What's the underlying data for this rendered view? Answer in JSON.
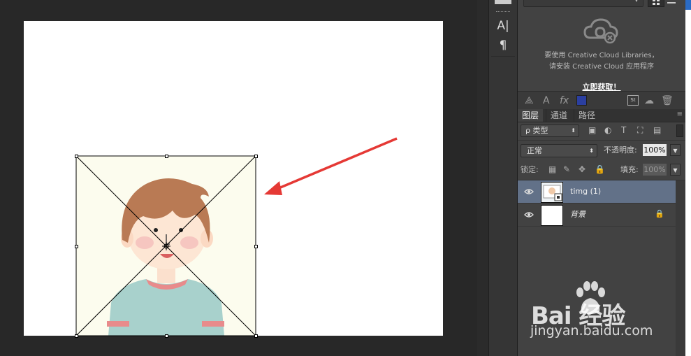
{
  "canvas": {
    "document_color": "#ffffff",
    "photo_bg": "#fcfcee",
    "arrow_color": "#e53935"
  },
  "toolbar": {
    "tools": [
      {
        "name": "character",
        "glyph": "A|"
      },
      {
        "name": "paragraph",
        "glyph": "¶"
      }
    ]
  },
  "libraries": {
    "message_line1": "要使用 Creative Cloud Libraries，",
    "message_line2": "请安装 Creative Cloud 应用程序",
    "get_link": "立即获取！",
    "fx_label": "fx",
    "text_tool": "A",
    "stock_label": "St",
    "color_swatch": "#2b3fa0"
  },
  "layers_panel": {
    "tabs": [
      "图层",
      "通道",
      "路径"
    ],
    "active_tab": "图层",
    "filter_kind": "ρ 类型",
    "blend_mode": "正常",
    "opacity_label": "不透明度:",
    "opacity_value": "100%",
    "lock_label": "锁定:",
    "fill_label": "填充:",
    "fill_value": "100%",
    "layers": [
      {
        "name": "timg (1)",
        "selected": true,
        "visible": true,
        "locked": false
      },
      {
        "name": "背景",
        "selected": false,
        "visible": true,
        "locked": true
      }
    ]
  },
  "watermark": {
    "logo_text": "Bai  经验",
    "url": "jingyan.baidu.com"
  }
}
